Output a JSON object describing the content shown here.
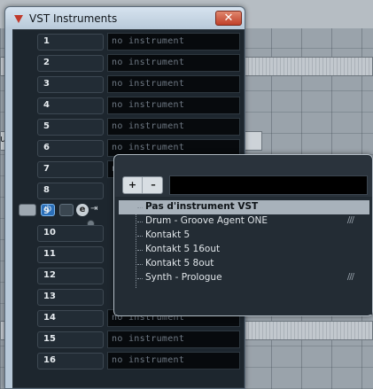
{
  "window": {
    "title": "VST Instruments",
    "close_label": "✕"
  },
  "background": {
    "partial_label": "ula"
  },
  "slots": [
    {
      "number": "1",
      "instrument": "no instrument"
    },
    {
      "number": "2",
      "instrument": "no instrument"
    },
    {
      "number": "3",
      "instrument": "no instrument"
    },
    {
      "number": "4",
      "instrument": "no instrument"
    },
    {
      "number": "5",
      "instrument": "no instrument"
    },
    {
      "number": "6",
      "instrument": "no instrument"
    },
    {
      "number": "7",
      "instrument": "no instrument"
    },
    {
      "number": "8",
      "instrument": ""
    },
    {
      "number": "9",
      "instrument": ""
    },
    {
      "number": "10",
      "instrument": ""
    },
    {
      "number": "11",
      "instrument": ""
    },
    {
      "number": "12",
      "instrument": ""
    },
    {
      "number": "13",
      "instrument": ""
    },
    {
      "number": "14",
      "instrument": "no instrument"
    },
    {
      "number": "15",
      "instrument": "no instrument"
    },
    {
      "number": "16",
      "instrument": "no instrument"
    }
  ],
  "slot_controls": {
    "power_glyph": "⏻",
    "edit_glyph": "e",
    "output_glyph": "⇥"
  },
  "popup": {
    "plus_label": "+",
    "minus_label": "–",
    "search_value": "",
    "items": [
      {
        "label": "Pas d'instrument VST",
        "selected": true,
        "marks": ""
      },
      {
        "label": "Drum - Groove Agent ONE",
        "selected": false,
        "marks": "///"
      },
      {
        "label": "Kontakt 5",
        "selected": false,
        "marks": ""
      },
      {
        "label": "Kontakt 5 16out",
        "selected": false,
        "marks": ""
      },
      {
        "label": "Kontakt 5 8out",
        "selected": false,
        "marks": ""
      },
      {
        "label": "Synth - Prologue",
        "selected": false,
        "marks": "///"
      }
    ]
  },
  "colors": {
    "rack_background": "#1d262e",
    "selected_item": "#a8b2bb",
    "power_active": "#2b6fb8",
    "close_button": "#c0412a"
  }
}
